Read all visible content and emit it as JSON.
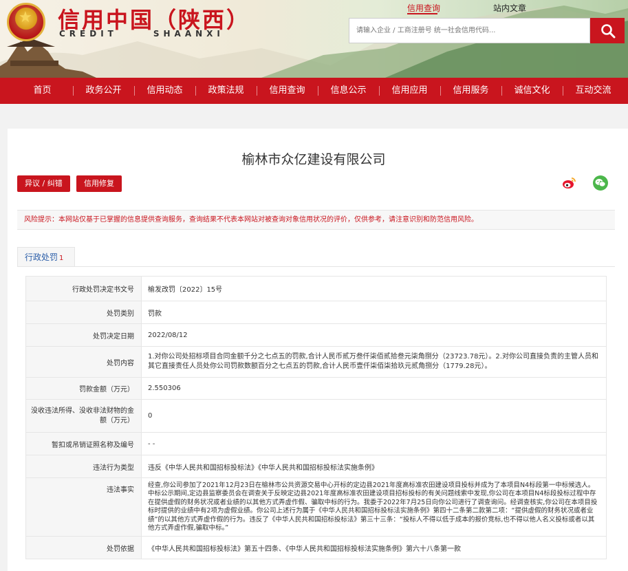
{
  "header": {
    "brand_cn": "信用中国（陕西）",
    "brand_en_left": "CREDIT",
    "brand_en_right": "SHAANXI",
    "top_links": [
      "信用查询",
      "站内文章"
    ],
    "search_placeholder": "请输入企业 / 工商注册号 统一社会信用代码...",
    "search_icon": "search-icon",
    "emblem_icon": "national-emblem-icon"
  },
  "nav": [
    "首页",
    "政务公开",
    "信用动态",
    "政策法规",
    "信用查询",
    "信息公示",
    "信用应用",
    "信用服务",
    "诚信文化",
    "互动交流"
  ],
  "company": {
    "name": "榆林市众亿建设有限公司",
    "objection_button": "异议 / 纠错",
    "repair_button": "信用修复",
    "share_icons": [
      "weibo-icon",
      "wechat-icon"
    ]
  },
  "notice": "风险提示：本网站仅基于已掌握的信息提供查询服务，查询结果不代表本网站对被查询对象信用状况的评价，仅供参考，请注意识别和防范信用风险。",
  "tab": {
    "label": "行政处罚",
    "count": "1"
  },
  "penalty": [
    {
      "label": "行政处罚决定书文号",
      "value": "榆发改罚〔2022〕15号"
    },
    {
      "label": "处罚类别",
      "value": "罚款"
    },
    {
      "label": "处罚决定日期",
      "value": "2022/08/12"
    },
    {
      "label": "处罚内容",
      "value": "1.对你公司处招标项目合同金额千分之七点五的罚款,合计人民币贰万叁仟柒佰贰拾叁元柒角捌分（23723.78元）。2.对你公司直接负责的主管人员和其它直接责任人员处你公司罚款数额百分之七点五的罚款,合计人民币壹仟柒佰柒拾玖元贰角捌分（1779.28元）。"
    },
    {
      "label": "罚款金额（万元）",
      "value": "2.550306"
    },
    {
      "label": "没收违法所得、没收非法财物的金额（万元）",
      "value": "0"
    },
    {
      "label": "暂扣或吊销证照名称及编号",
      "value": "- -"
    },
    {
      "label": "违法行为类型",
      "value": "违反《中华人民共和国招标投标法》《中华人民共和国招标投标法实施条例》"
    },
    {
      "label": "违法事实",
      "value": "经查,你公司参加了2021年12月23日在榆林市公共资源交易中心开标的定边县2021年度高标准农田建设项目投标并成为了本项目N4标段第一中标候选人。中标公示期间,定边县监察委员会在调查关于反映定边县2021年度高标准农田建设项目招标投标的有关问题线索中发现,你公司在本项目N4标段投标过程中存在提供虚假的财务状况或者业绩的以其他方式弄虚作假、骗取中标的行为。我委于2022年7月25日向你公司进行了调查询问。经调查核实,你公司在本项目投标时提供的业绩中有2项为虚假业绩。你公司上述行为属于《中华人民共和国招标投标法实施条例》第四十二条第二款第二项：“提供虚假的财务状况或者业绩”的以其他方式弄虚作假的行为。违反了《中华人民共和国招标投标法》第三十三条：“投标人不得以低于成本的报价竞标,也不得以他人名义投标或者以其他方式弄虚作假,骗取中标。”"
    },
    {
      "label": "处罚依据",
      "value": "《中华人民共和国招标投标法》第五十四条、《中华人民共和国招标投标法实施条例》第六十八条第一款"
    }
  ],
  "colors": {
    "brand_red": "#c9151e",
    "link_blue": "#2a5da8"
  }
}
